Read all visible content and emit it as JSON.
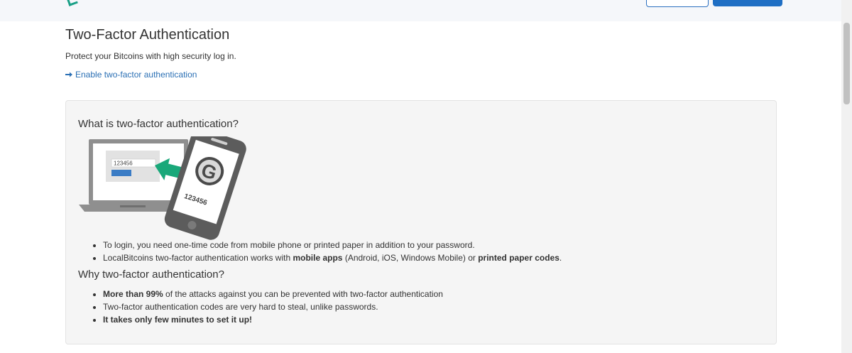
{
  "page": {
    "title": "Two-Factor Authentication",
    "subtitle": "Protect your Bitcoins with high security log in.",
    "enable_link": "Enable two-factor authentication"
  },
  "panel": {
    "what_heading": "What is two-factor authentication?",
    "illustration": {
      "laptop_code": "123456",
      "phone_code": "123456",
      "phone_letter": "G"
    },
    "what_bullets": {
      "b1": "To login, you need one-time code from mobile phone or printed paper in addition to your password.",
      "b2_a": "LocalBitcoins two-factor authentication works with ",
      "b2_b": "mobile apps",
      "b2_c": " (Android, iOS, Windows Mobile) or ",
      "b2_d": "printed paper codes",
      "b2_e": "."
    },
    "why_heading": "Why two-factor authentication?",
    "why_bullets": {
      "b1_bold": "More than 99%",
      "b1_rest": " of the attacks against you can be prevented with two-factor authentication",
      "b2": "Two-factor authentication codes are very hard to steal, unlike passwords.",
      "b3": "It takes only few minutes to set it up!"
    }
  },
  "colors": {
    "link": "#2a6fb4",
    "primary_button": "#1f6fc4",
    "arrow_green": "#1aa87a",
    "panel_bg": "#f5f5f5"
  }
}
